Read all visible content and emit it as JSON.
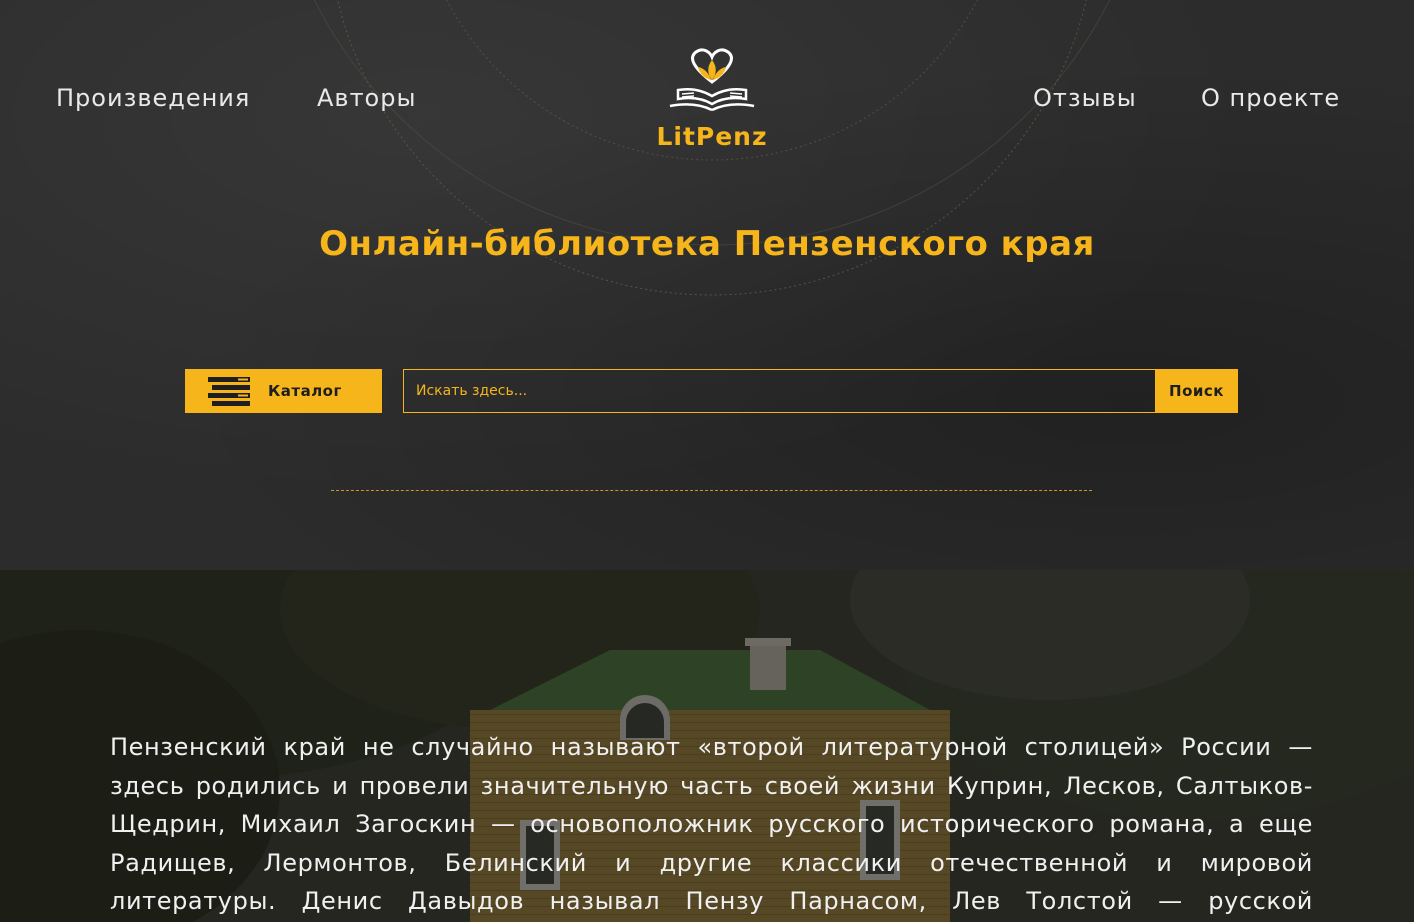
{
  "nav": {
    "left": [
      {
        "label": "Произведения"
      },
      {
        "label": "Авторы"
      }
    ],
    "right": [
      {
        "label": "Отзывы"
      },
      {
        "label": "О проекте"
      }
    ]
  },
  "logo": {
    "text": "LitPenz"
  },
  "headline": "Онлайн-библиотека Пензенского края",
  "catalog": {
    "label": "Каталог"
  },
  "search": {
    "placeholder": "Искать здесь...",
    "button_label": "Поиск"
  },
  "intro_text": "Пензенский край не случайно называют «второй литературной столицей» России — здесь родились и провели значительную часть своей жизни Куприн, Лесков, Салтыков-Щедрин, Михаил Загоскин — основоположник русского исторического романа, а еще Радищев, Лермонтов, Белинский и другие классики отечественной и мировой литературы. Денис Давыдов называл Пензу Парнасом, Лев Толстой — русской",
  "colors": {
    "accent": "#f5b51b",
    "background": "#2c2c2c",
    "text": "#e9e9e9"
  }
}
